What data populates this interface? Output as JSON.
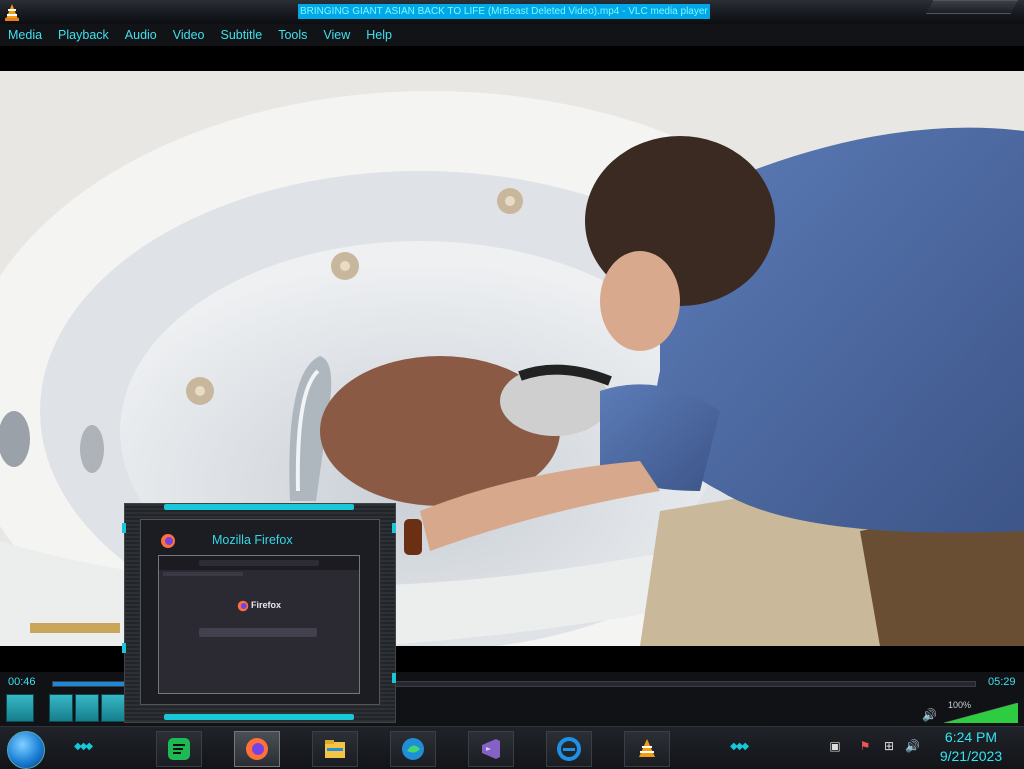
{
  "window": {
    "title": "BRINGING GIANT ASIAN BACK TO LIFE (MrBeast Deleted Video).mp4 - VLC media player"
  },
  "menu": {
    "items": [
      "Media",
      "Playback",
      "Audio",
      "Video",
      "Subtitle",
      "Tools",
      "View",
      "Help"
    ]
  },
  "player": {
    "elapsed": "00:46",
    "duration": "05:29",
    "progress_fraction": 0.14,
    "volume_label": "100%",
    "volume_fraction": 1.0
  },
  "preview": {
    "title": "Mozilla Firefox",
    "thumbnail_label": "Firefox"
  },
  "taskbar": {
    "apps": [
      {
        "name": "spotify-icon"
      },
      {
        "name": "firefox-icon"
      },
      {
        "name": "file-explorer-icon"
      },
      {
        "name": "edge-icon"
      },
      {
        "name": "visual-studio-icon"
      },
      {
        "name": "internet-explorer-icon"
      },
      {
        "name": "vlc-icon"
      }
    ],
    "active_app": "firefox-icon",
    "tray_icons": [
      "network-monitor-icon",
      "security-flag-icon",
      "network-icon",
      "volume-icon"
    ],
    "clock_time": "6:24 PM",
    "clock_date": "9/21/2023"
  },
  "colors": {
    "accent": "#3fe0ee",
    "title_highlight": "#00a8e8",
    "seek_fill": "#1e88d8",
    "volume_green": "#2ecc40"
  }
}
